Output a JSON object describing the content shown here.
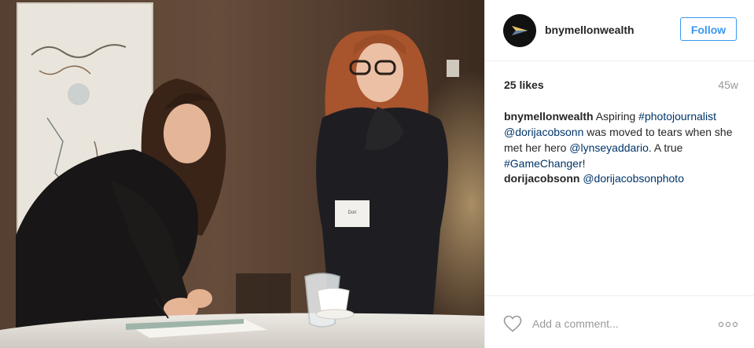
{
  "header": {
    "username": "bnymellonwealth",
    "follow_label": "Follow"
  },
  "stats": {
    "likes": "25 likes",
    "age": "45w"
  },
  "caption": {
    "user": "bnymellonwealth",
    "text_1": " Aspiring ",
    "hashtag_1": "#photojournalist",
    "mention_1": "@dorijacobsonn",
    "text_2": " was moved to tears when she met her hero ",
    "mention_2": "@lynseyaddario",
    "text_3": ". A true ",
    "hashtag_2": "#GameChanger",
    "text_4": "!"
  },
  "comment": {
    "user": "dorijacobsonn",
    "mention": "@dorijacobsonphoto"
  },
  "footer": {
    "comment_placeholder": "Add a comment..."
  },
  "photo": {
    "name_tag": "Dori"
  },
  "colors": {
    "follow_blue": "#3897f0",
    "link_blue": "#003569",
    "muted_gray": "#999999",
    "divider": "#efefef",
    "text": "#262626"
  },
  "icons": {
    "like": "heart-outline-icon",
    "more": "more-options-icon",
    "avatar": "bny-mellon-arrow-logo"
  }
}
